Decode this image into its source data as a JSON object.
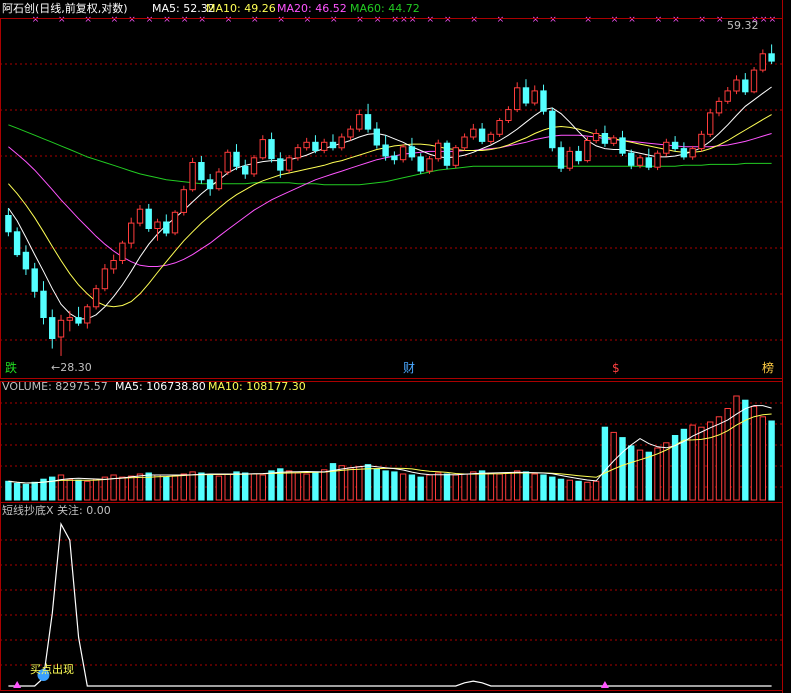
{
  "header": {
    "stock_title": "阿石创(日线,前复权,对数)",
    "ma5": "MA5: 52.32",
    "ma10": "MA10: 49.26",
    "ma20": "MA20: 46.52",
    "ma60": "MA60: 44.72"
  },
  "price_panel": {
    "high_label": "59.32",
    "low_label": "←28.30",
    "markers": [
      "跌",
      "财",
      "$",
      "榜"
    ]
  },
  "volume_header": {
    "volume": "VOLUME: 82975.57",
    "ma5": "MA5: 106738.80",
    "ma10": "MA10: 108177.30"
  },
  "indicator_header": {
    "title": "短线抄底X 关注: 0.00",
    "signal_label": "买点出现"
  },
  "colors": {
    "background": "#000000",
    "up": "#ff3c3c",
    "down": "#54ffff",
    "ma5": "#ffffff",
    "ma10": "#ffff55",
    "ma20": "#ff55ff",
    "ma60": "#22cc22",
    "grid": "#aa0000",
    "indicator_line": "#ffffff",
    "cross_marker": "#ff55ff"
  },
  "chart_data": [
    {
      "type": "candlestick",
      "title": "阿石创(日线,前复权,对数)",
      "scale": "log",
      "series_names": [
        "MA5",
        "MA10",
        "MA20",
        "MA60"
      ],
      "ma_last": {
        "MA5": 52.32,
        "MA10": 49.26,
        "MA20": 46.52,
        "MA60": 44.72
      },
      "annotations": [
        {
          "text": "59.32",
          "value": 59.32
        },
        {
          "text": "28.30",
          "value": 28.3
        }
      ],
      "ohlc_approx": [
        [
          39.5,
          40.2,
          37.6,
          38.0
        ],
        [
          38.0,
          38.4,
          35.8,
          36.0
        ],
        [
          36.2,
          36.8,
          34.3,
          34.8
        ],
        [
          34.8,
          35.3,
          32.5,
          33.0
        ],
        [
          33.0,
          33.8,
          30.5,
          31.0
        ],
        [
          31.0,
          31.6,
          28.8,
          29.5
        ],
        [
          29.6,
          31.2,
          28.3,
          30.8
        ],
        [
          30.8,
          31.5,
          30.0,
          31.0
        ],
        [
          31.0,
          31.8,
          30.4,
          30.6
        ],
        [
          30.6,
          32.0,
          30.2,
          31.8
        ],
        [
          31.8,
          33.5,
          31.6,
          33.2
        ],
        [
          33.2,
          35.2,
          33.0,
          34.8
        ],
        [
          34.8,
          36.0,
          34.4,
          35.5
        ],
        [
          35.5,
          37.2,
          35.2,
          37.0
        ],
        [
          37.0,
          39.3,
          36.6,
          38.8
        ],
        [
          38.8,
          40.5,
          38.5,
          40.1
        ],
        [
          40.1,
          40.6,
          38.0,
          38.3
        ],
        [
          38.3,
          39.2,
          37.2,
          38.9
        ],
        [
          38.9,
          39.6,
          37.6,
          37.9
        ],
        [
          37.9,
          40.0,
          37.7,
          39.8
        ],
        [
          39.8,
          42.4,
          39.5,
          42.0
        ],
        [
          42.0,
          45.3,
          41.8,
          44.8
        ],
        [
          44.8,
          45.5,
          42.6,
          43.0
        ],
        [
          43.0,
          43.6,
          41.4,
          42.1
        ],
        [
          42.1,
          44.2,
          41.9,
          43.8
        ],
        [
          43.8,
          46.2,
          43.5,
          45.9
        ],
        [
          45.9,
          46.8,
          44.0,
          44.4
        ],
        [
          44.4,
          45.1,
          43.1,
          43.6
        ],
        [
          43.6,
          45.6,
          43.3,
          45.3
        ],
        [
          45.3,
          47.8,
          45.1,
          47.3
        ],
        [
          47.3,
          48.1,
          44.8,
          45.2
        ],
        [
          45.2,
          45.9,
          43.2,
          44.0
        ],
        [
          44.0,
          45.6,
          43.7,
          45.3
        ],
        [
          45.3,
          46.8,
          45.0,
          46.4
        ],
        [
          46.4,
          47.5,
          46.1,
          47.0
        ],
        [
          47.0,
          47.8,
          45.8,
          46.1
        ],
        [
          46.1,
          47.4,
          45.8,
          47.0
        ],
        [
          47.0,
          47.9,
          46.1,
          46.4
        ],
        [
          46.4,
          48.0,
          46.1,
          47.6
        ],
        [
          47.6,
          48.9,
          47.2,
          48.5
        ],
        [
          48.5,
          50.8,
          48.2,
          50.2
        ],
        [
          50.2,
          51.5,
          48.1,
          48.5
        ],
        [
          48.5,
          49.3,
          46.3,
          46.7
        ],
        [
          46.7,
          47.8,
          45.0,
          45.5
        ],
        [
          45.5,
          46.0,
          44.6,
          45.1
        ],
        [
          45.1,
          46.8,
          44.8,
          46.5
        ],
        [
          46.5,
          47.5,
          45.0,
          45.4
        ],
        [
          45.4,
          45.8,
          43.6,
          43.9
        ],
        [
          43.9,
          45.5,
          43.6,
          45.2
        ],
        [
          45.2,
          47.3,
          44.9,
          46.9
        ],
        [
          46.9,
          47.2,
          44.1,
          44.5
        ],
        [
          44.5,
          46.7,
          44.2,
          46.4
        ],
        [
          46.4,
          48.0,
          46.1,
          47.6
        ],
        [
          47.6,
          49.1,
          47.3,
          48.5
        ],
        [
          48.5,
          49.2,
          46.8,
          47.1
        ],
        [
          47.1,
          48.2,
          46.8,
          47.9
        ],
        [
          47.9,
          49.8,
          47.6,
          49.5
        ],
        [
          49.5,
          51.2,
          49.2,
          50.8
        ],
        [
          50.8,
          54.2,
          50.5,
          53.5
        ],
        [
          53.5,
          54.6,
          51.2,
          51.6
        ],
        [
          51.6,
          53.8,
          51.3,
          53.1
        ],
        [
          53.1,
          53.9,
          50.2,
          50.6
        ],
        [
          50.6,
          51.0,
          46.0,
          46.4
        ],
        [
          46.4,
          47.1,
          43.8,
          44.2
        ],
        [
          44.2,
          46.5,
          43.9,
          46.0
        ],
        [
          46.0,
          46.6,
          44.6,
          45.0
        ],
        [
          45.0,
          47.6,
          44.8,
          47.2
        ],
        [
          47.2,
          48.5,
          46.9,
          48.0
        ],
        [
          48.0,
          48.9,
          46.5,
          46.9
        ],
        [
          46.9,
          47.8,
          46.6,
          47.5
        ],
        [
          47.5,
          48.3,
          45.5,
          45.8
        ],
        [
          45.8,
          46.2,
          44.1,
          44.5
        ],
        [
          44.5,
          45.6,
          44.2,
          45.3
        ],
        [
          45.3,
          46.3,
          44.0,
          44.3
        ],
        [
          44.3,
          46.1,
          44.0,
          45.8
        ],
        [
          45.8,
          47.4,
          45.5,
          47.0
        ],
        [
          47.0,
          47.7,
          46.0,
          46.3
        ],
        [
          46.3,
          47.0,
          45.1,
          45.4
        ],
        [
          45.4,
          46.6,
          45.1,
          46.3
        ],
        [
          46.3,
          48.3,
          46.0,
          47.9
        ],
        [
          47.9,
          50.9,
          47.6,
          50.4
        ],
        [
          50.4,
          52.3,
          50.0,
          51.8
        ],
        [
          51.8,
          53.6,
          51.5,
          53.1
        ],
        [
          53.1,
          55.1,
          52.7,
          54.5
        ],
        [
          54.5,
          55.4,
          52.6,
          53.0
        ],
        [
          53.0,
          56.2,
          52.8,
          55.8
        ],
        [
          55.8,
          58.6,
          55.5,
          58.0
        ],
        [
          58.0,
          59.3,
          56.6,
          57.0
        ]
      ],
      "ma5_approx": [
        40.2,
        39.0,
        37.5,
        36.0,
        34.6,
        33.2,
        32.0,
        31.3,
        30.9,
        30.9,
        31.2,
        31.8,
        32.6,
        33.5,
        34.6,
        35.8,
        36.9,
        37.8,
        38.6,
        39.3,
        40.0,
        40.8,
        41.6,
        42.3,
        43.0,
        43.7,
        44.2,
        44.5,
        44.7,
        44.9,
        45.0,
        45.0,
        45.1,
        45.3,
        45.6,
        46.0,
        46.3,
        46.6,
        46.9,
        47.2,
        47.6,
        47.9,
        48.0,
        47.8,
        47.4,
        47.0,
        46.5,
        46.1,
        45.7,
        45.4,
        45.3,
        45.4,
        45.6,
        45.9,
        46.3,
        46.7,
        47.2,
        47.8,
        48.5,
        49.3,
        50.1,
        50.8,
        51.0,
        50.3,
        49.3,
        48.2,
        47.2,
        46.6,
        46.3,
        46.2,
        46.2,
        46.0,
        45.8,
        45.6,
        45.4,
        45.4,
        45.5,
        45.7,
        46.0,
        46.4,
        47.1,
        48.0,
        49.0,
        50.1,
        51.2,
        52.0,
        52.8,
        53.6
      ],
      "ma10_approx": [
        42.6,
        41.6,
        40.5,
        39.3,
        38.0,
        36.7,
        35.5,
        34.4,
        33.5,
        32.8,
        32.2,
        31.9,
        31.8,
        31.9,
        32.2,
        32.8,
        33.6,
        34.5,
        35.4,
        36.3,
        37.2,
        38.0,
        38.8,
        39.5,
        40.2,
        40.9,
        41.5,
        42.0,
        42.5,
        42.9,
        43.2,
        43.5,
        43.7,
        43.9,
        44.1,
        44.3,
        44.5,
        44.8,
        45.0,
        45.3,
        45.6,
        45.9,
        46.2,
        46.4,
        46.6,
        46.7,
        46.8,
        46.8,
        46.7,
        46.5,
        46.3,
        46.2,
        46.1,
        46.1,
        46.1,
        46.2,
        46.4,
        46.7,
        47.1,
        47.5,
        48.0,
        48.4,
        48.7,
        48.8,
        48.7,
        48.5,
        48.2,
        47.9,
        47.6,
        47.4,
        47.2,
        47.0,
        46.8,
        46.6,
        46.4,
        46.2,
        46.0,
        45.9,
        45.9,
        46.0,
        46.3,
        46.7,
        47.2,
        47.8,
        48.4,
        49.0,
        49.6,
        50.2
      ],
      "ma20_approx": [
        46.5,
        45.7,
        44.9,
        44.0,
        43.0,
        42.0,
        41.0,
        40.1,
        39.2,
        38.4,
        37.6,
        36.9,
        36.3,
        35.8,
        35.4,
        35.1,
        35.0,
        35.0,
        35.1,
        35.3,
        35.6,
        36.0,
        36.5,
        37.0,
        37.6,
        38.2,
        38.8,
        39.4,
        40.0,
        40.5,
        41.0,
        41.4,
        41.8,
        42.2,
        42.6,
        43.0,
        43.3,
        43.6,
        43.9,
        44.2,
        44.5,
        44.8,
        45.1,
        45.3,
        45.5,
        45.7,
        45.8,
        45.9,
        46.0,
        46.0,
        46.0,
        46.0,
        46.1,
        46.1,
        46.2,
        46.3,
        46.4,
        46.6,
        46.8,
        47.0,
        47.3,
        47.5,
        47.7,
        47.8,
        47.8,
        47.8,
        47.7,
        47.6,
        47.4,
        47.3,
        47.2,
        47.1,
        47.0,
        46.9,
        46.8,
        46.7,
        46.6,
        46.5,
        46.5,
        46.5,
        46.5,
        46.6,
        46.7,
        46.9,
        47.1,
        47.4,
        47.7,
        48.0
      ],
      "ma60_approx": [
        49.0,
        48.6,
        48.2,
        47.8,
        47.4,
        47.0,
        46.6,
        46.2,
        45.8,
        45.4,
        45.1,
        44.8,
        44.5,
        44.2,
        43.9,
        43.6,
        43.4,
        43.2,
        43.0,
        42.9,
        42.8,
        42.7,
        42.6,
        42.6,
        42.6,
        42.6,
        42.6,
        42.6,
        42.7,
        42.7,
        42.7,
        42.7,
        42.7,
        42.6,
        42.6,
        42.6,
        42.5,
        42.5,
        42.5,
        42.5,
        42.5,
        42.6,
        42.7,
        42.8,
        43.0,
        43.2,
        43.4,
        43.6,
        43.8,
        44.0,
        44.1,
        44.2,
        44.3,
        44.4,
        44.4,
        44.4,
        44.4,
        44.4,
        44.4,
        44.4,
        44.4,
        44.4,
        44.4,
        44.4,
        44.4,
        44.4,
        44.4,
        44.4,
        44.4,
        44.4,
        44.4,
        44.4,
        44.4,
        44.4,
        44.4,
        44.4,
        44.4,
        44.5,
        44.5,
        44.5,
        44.6,
        44.6,
        44.6,
        44.6,
        44.7,
        44.7,
        44.7,
        44.7
      ]
    },
    {
      "type": "bar",
      "title": "VOLUME",
      "series_names": [
        "VOLUME",
        "MA5",
        "MA10"
      ],
      "last": {
        "VOLUME": 82975.57,
        "MA5": 106738.8,
        "MA10": 108177.3
      },
      "relative_volume_approx": [
        0.18,
        0.16,
        0.15,
        0.17,
        0.2,
        0.22,
        0.24,
        0.2,
        0.19,
        0.18,
        0.2,
        0.22,
        0.24,
        0.22,
        0.23,
        0.25,
        0.26,
        0.24,
        0.22,
        0.23,
        0.25,
        0.27,
        0.26,
        0.24,
        0.23,
        0.25,
        0.27,
        0.26,
        0.25,
        0.24,
        0.28,
        0.3,
        0.28,
        0.26,
        0.25,
        0.27,
        0.29,
        0.35,
        0.33,
        0.31,
        0.32,
        0.34,
        0.3,
        0.28,
        0.27,
        0.25,
        0.24,
        0.22,
        0.24,
        0.26,
        0.25,
        0.24,
        0.25,
        0.27,
        0.28,
        0.26,
        0.25,
        0.26,
        0.28,
        0.27,
        0.25,
        0.24,
        0.22,
        0.2,
        0.19,
        0.18,
        0.17,
        0.18,
        0.7,
        0.65,
        0.6,
        0.52,
        0.48,
        0.46,
        0.5,
        0.55,
        0.62,
        0.68,
        0.72,
        0.7,
        0.75,
        0.8,
        0.88,
        1.0,
        0.96,
        0.9,
        0.8,
        0.76
      ]
    },
    {
      "type": "line",
      "title": "短线抄底X",
      "series_names": [
        "关注"
      ],
      "last": {
        "关注": 0.0
      },
      "annotations": [
        {
          "text": "买点出现"
        }
      ],
      "values_approx": [
        0.0,
        0.0,
        0.0,
        0.0,
        0.05,
        0.45,
        1.0,
        0.9,
        0.3,
        0.0,
        0.0,
        0.0,
        0.0,
        0.0,
        0.0,
        0.0,
        0.0,
        0.0,
        0.0,
        0.0,
        0.0,
        0.0,
        0.0,
        0.0,
        0.0,
        0.0,
        0.0,
        0.0,
        0.0,
        0.0,
        0.0,
        0.0,
        0.0,
        0.0,
        0.0,
        0.0,
        0.0,
        0.0,
        0.0,
        0.0,
        0.0,
        0.0,
        0.0,
        0.0,
        0.0,
        0.0,
        0.0,
        0.0,
        0.0,
        0.0,
        0.0,
        0.0,
        0.02,
        0.03,
        0.02,
        0.0,
        0.0,
        0.0,
        0.0,
        0.0,
        0.0,
        0.0,
        0.0,
        0.0,
        0.0,
        0.0,
        0.0,
        0.0,
        0.0,
        0.0,
        0.0,
        0.0,
        0.0,
        0.0,
        0.0,
        0.0,
        0.0,
        0.0,
        0.0,
        0.0,
        0.0,
        0.0,
        0.0,
        0.0,
        0.0,
        0.0,
        0.0,
        0.0
      ]
    }
  ]
}
